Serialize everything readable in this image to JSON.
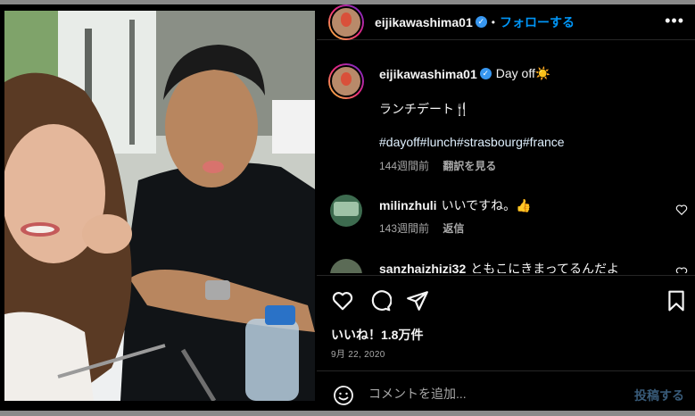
{
  "post": {
    "username": "eijikawashima01",
    "follow_label": "フォローする",
    "dot": "•",
    "more_label": "•••"
  },
  "caption": {
    "username": "eijikawashima01",
    "line1": "Day off☀️",
    "line2": "ランチデート🍴",
    "hashtags": "#dayoff#lunch#strasbourg#france",
    "time": "144週間前",
    "translate": "翻訳を見る"
  },
  "comments": [
    {
      "username": "milinzhuli",
      "text": "いいですね。👍",
      "time": "143週間前",
      "reply": "返信"
    },
    {
      "username": "sanzhaizhizi32",
      "text": "ともこにきまってるんだよ"
    }
  ],
  "stats": {
    "likes": "いいね！1.8万件",
    "date": "9月 22, 2020"
  },
  "composer": {
    "placeholder": "コメントを追加...",
    "post_label": "投稿する"
  },
  "icons": {
    "verified": "verified-badge-icon",
    "like": "heart-icon",
    "comment": "comment-bubble-icon",
    "share": "paper-plane-icon",
    "save": "bookmark-icon",
    "emoji": "smiley-icon"
  },
  "colors": {
    "background": "#000000",
    "link": "#0095f6",
    "muted": "#a8a8a8",
    "post_disabled": "#385a78"
  }
}
